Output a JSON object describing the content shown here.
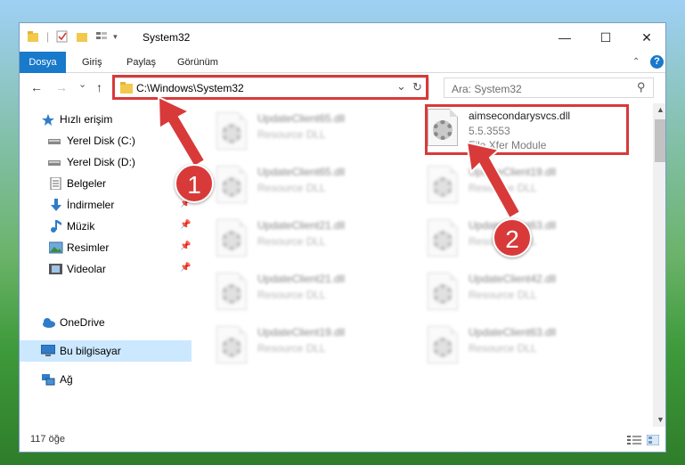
{
  "window": {
    "title": "System32",
    "controls": {
      "minimize": "—",
      "maximize": "☐",
      "close": "✕"
    }
  },
  "ribbon": {
    "tabs": [
      {
        "label": "Dosya",
        "active": true
      },
      {
        "label": "Giriş"
      },
      {
        "label": "Paylaş"
      },
      {
        "label": "Görünüm"
      }
    ],
    "expand_icon": "chevron-up-icon",
    "help_icon": "?"
  },
  "navbar": {
    "back": "←",
    "forward": "→",
    "history": "⌄",
    "up": "↑",
    "address_path": "C:\\Windows\\System32",
    "dropdown": "⌄",
    "refresh": "↻",
    "search_placeholder": "Ara: System32",
    "search_icon": "⚲"
  },
  "sidebar": {
    "items": [
      {
        "label": "Hızlı erişim",
        "icon": "star-icon",
        "pinned": false
      },
      {
        "label": "Yerel Disk (C:)",
        "icon": "drive-icon",
        "pinned": true
      },
      {
        "label": "Yerel Disk (D:)",
        "icon": "drive-icon",
        "pinned": true
      },
      {
        "label": "Belgeler",
        "icon": "document-icon",
        "pinned": true
      },
      {
        "label": "İndirmeler",
        "icon": "download-icon",
        "pinned": true
      },
      {
        "label": "Müzik",
        "icon": "music-icon",
        "pinned": true
      },
      {
        "label": "Resimler",
        "icon": "pictures-icon",
        "pinned": true
      },
      {
        "label": "Videolar",
        "icon": "video-icon",
        "pinned": true
      },
      {
        "label": "OneDrive",
        "icon": "cloud-icon"
      },
      {
        "label": "Bu bilgisayar",
        "icon": "computer-icon",
        "selected": true
      },
      {
        "label": "Ağ",
        "icon": "network-icon"
      }
    ],
    "pin_glyph": "📌"
  },
  "files": [
    {
      "name": "UpdateClient65.dll",
      "type": "Resource DLL"
    },
    {
      "name": "aimsecondarysvcs.dll",
      "version": "5.5.3553",
      "type": "File Xfer Module"
    },
    {
      "name": "UpdateClient65.dll",
      "type": "Resource DLL"
    },
    {
      "name": "UpdateClient19.dll",
      "type": "Resource DLL"
    },
    {
      "name": "UpdateClient21.dll",
      "type": "Resource DLL"
    },
    {
      "name": "UpdateClient63.dll",
      "type": "Resource DLL"
    },
    {
      "name": "UpdateClient21.dll",
      "type": "Resource DLL"
    },
    {
      "name": "UpdateClient42.dll",
      "type": "Resource DLL"
    },
    {
      "name": "UpdateClient19.dll",
      "type": "Resource DLL"
    },
    {
      "name": "UpdateClient63.dll",
      "type": "Resource DLL"
    }
  ],
  "status": {
    "item_count": "117 öğe"
  },
  "annotations": {
    "step1": "1",
    "step2": "2",
    "color": "#d83a3a"
  }
}
